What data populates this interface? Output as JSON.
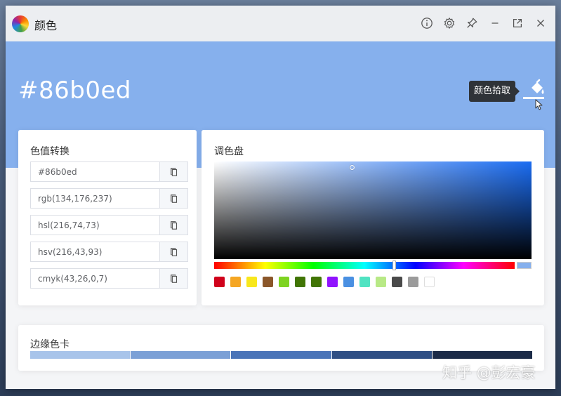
{
  "window": {
    "title": "颜色"
  },
  "titlebar": {
    "icons": [
      "info-icon",
      "gear-icon",
      "pin-icon",
      "minimize-icon",
      "popout-icon",
      "close-icon"
    ]
  },
  "hero": {
    "hex": "#86b0ed",
    "background": "#86b0ed",
    "tooltip": "颜色拾取"
  },
  "conversion": {
    "title": "色值转换",
    "values": [
      "#86b0ed",
      "rgb(134,176,237)",
      "hsl(216,74,73)",
      "hsv(216,43,93)",
      "cmyk(43,26,0,7)"
    ]
  },
  "palette": {
    "title": "调色盘",
    "base_hue_color": "#1a6cf2",
    "swatches": [
      "#d0021b",
      "#f5a623",
      "#f8e71c",
      "#8b572a",
      "#7ed321",
      "#417505",
      "#417505",
      "#9013fe",
      "#4a90e2",
      "#50e3c2",
      "#b8e986",
      "#4a4a4a",
      "#9b9b9b",
      "#ffffff"
    ]
  },
  "edge": {
    "title": "边缘色卡",
    "colors": [
      "#a8c4ea",
      "#7ba0d6",
      "#4a74b8",
      "#2f4f85",
      "#1c2b48"
    ]
  },
  "watermark": "知乎 @彭宏豪"
}
